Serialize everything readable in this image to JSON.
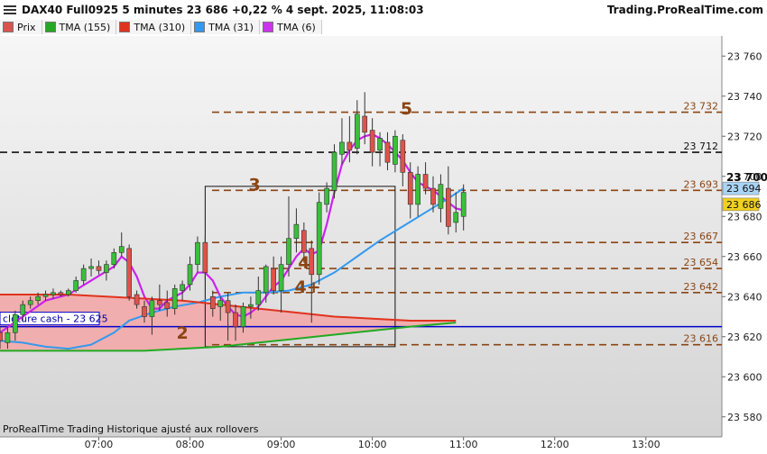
{
  "header": {
    "title": "DAX40 Full0925 5 minutes 23 686 +0,22 % 4 sept. 2025, 11:08:03",
    "site": "Trading.ProRealTime.com"
  },
  "legend": [
    {
      "label": "Prix",
      "color": "#d9534f"
    },
    {
      "label": "TMA (155)",
      "color": "#22aa22"
    },
    {
      "label": "TMA (310)",
      "color": "#e0331e"
    },
    {
      "label": "TMA (31)",
      "color": "#3399ee"
    },
    {
      "label": "TMA (6)",
      "color": "#cc33ee"
    }
  ],
  "footer": {
    "note": "ProRealTime Trading  Historique ajusté aux rollovers"
  },
  "chart_data": {
    "type": "candlestick",
    "ylim": [
      23570,
      23770
    ],
    "y_ticks": [
      23580,
      23600,
      23620,
      23640,
      23660,
      23680,
      23700,
      23720,
      23740,
      23760
    ],
    "y_tick_labels": [
      "23 580",
      "23 600",
      "23 620",
      "23 640",
      "23 660",
      "23 680",
      "23 700",
      "23 720",
      "23 740",
      "23 760"
    ],
    "x_ticks": [
      {
        "t": 84,
        "label": "07:00"
      },
      {
        "t": 96,
        "label": "08:00"
      },
      {
        "t": 108,
        "label": "09:00"
      },
      {
        "t": 120,
        "label": "10:00"
      },
      {
        "t": 132,
        "label": "11:00"
      },
      {
        "t": 144,
        "label": "12:00"
      },
      {
        "t": 156,
        "label": "13:00"
      }
    ],
    "xlim": [
      71,
      166
    ],
    "candles": [
      [
        71,
        23622,
        23625,
        23614,
        23618
      ],
      [
        72,
        23617,
        23625,
        23614,
        23622
      ],
      [
        73,
        23622,
        23633,
        23618,
        23631
      ],
      [
        74,
        23631,
        23638,
        23628,
        23636
      ],
      [
        75,
        23636,
        23640,
        23634,
        23638
      ],
      [
        76,
        23638,
        23642,
        23636,
        23640
      ],
      [
        77,
        23640,
        23643,
        23638,
        23641
      ],
      [
        78,
        23641,
        23644,
        23639,
        23642
      ],
      [
        79,
        23642,
        23643,
        23640,
        23641
      ],
      [
        80,
        23641,
        23644,
        23640,
        23643
      ],
      [
        81,
        23643,
        23650,
        23642,
        23648
      ],
      [
        82,
        23648,
        23656,
        23646,
        23654
      ],
      [
        83,
        23654,
        23659,
        23650,
        23655
      ],
      [
        84,
        23655,
        23658,
        23651,
        23653
      ],
      [
        85,
        23652,
        23658,
        23648,
        23656
      ],
      [
        86,
        23656,
        23664,
        23654,
        23662
      ],
      [
        87,
        23662,
        23672,
        23660,
        23665
      ],
      [
        88,
        23664,
        23666,
        23638,
        23640
      ],
      [
        89,
        23641,
        23643,
        23634,
        23636
      ],
      [
        90,
        23635,
        23638,
        23627,
        23630
      ],
      [
        91,
        23630,
        23640,
        23621,
        23638
      ],
      [
        92,
        23638,
        23646,
        23633,
        23636
      ],
      [
        93,
        23637,
        23643,
        23630,
        23634
      ],
      [
        94,
        23634,
        23646,
        23631,
        23644
      ],
      [
        95,
        23643,
        23648,
        23638,
        23646
      ],
      [
        96,
        23646,
        23660,
        23643,
        23656
      ],
      [
        97,
        23656,
        23670,
        23652,
        23667
      ],
      [
        98,
        23667,
        23670,
        23648,
        23652
      ],
      [
        99,
        23640,
        23643,
        23630,
        23634
      ],
      [
        100,
        23635,
        23640,
        23628,
        23638
      ],
      [
        101,
        23638,
        23642,
        23618,
        23632
      ],
      [
        102,
        23632,
        23636,
        23618,
        23625
      ],
      [
        103,
        23625,
        23637,
        23622,
        23635
      ],
      [
        104,
        23635,
        23640,
        23629,
        23636
      ],
      [
        105,
        23636,
        23650,
        23633,
        23643
      ],
      [
        106,
        23642,
        23656,
        23637,
        23655
      ],
      [
        107,
        23654,
        23660,
        23641,
        23643
      ],
      [
        108,
        23643,
        23660,
        23632,
        23656
      ],
      [
        109,
        23656,
        23690,
        23650,
        23669
      ],
      [
        110,
        23669,
        23684,
        23662,
        23676
      ],
      [
        111,
        23673,
        23677,
        23657,
        23662
      ],
      [
        112,
        23664,
        23668,
        23627,
        23651
      ],
      [
        113,
        23651,
        23692,
        23646,
        23687
      ],
      [
        114,
        23686,
        23697,
        23682,
        23694
      ],
      [
        115,
        23693,
        23716,
        23689,
        23712
      ],
      [
        116,
        23711,
        23729,
        23706,
        23717
      ],
      [
        117,
        23717,
        23730,
        23707,
        23713
      ],
      [
        118,
        23714,
        23738,
        23711,
        23731
      ],
      [
        119,
        23730,
        23742,
        23716,
        23722
      ],
      [
        120,
        23723,
        23729,
        23705,
        23712
      ],
      [
        121,
        23713,
        23722,
        23705,
        23719
      ],
      [
        122,
        23717,
        23722,
        23703,
        23707
      ],
      [
        123,
        23706,
        23723,
        23702,
        23720
      ],
      [
        124,
        23718,
        23721,
        23695,
        23702
      ],
      [
        125,
        23702,
        23707,
        23679,
        23686
      ],
      [
        126,
        23686,
        23705,
        23680,
        23701
      ],
      [
        127,
        23701,
        23707,
        23691,
        23694
      ],
      [
        128,
        23694,
        23700,
        23682,
        23686
      ],
      [
        129,
        23684,
        23701,
        23677,
        23696
      ],
      [
        130,
        23694,
        23705,
        23671,
        23675
      ],
      [
        131,
        23677,
        23692,
        23672,
        23682
      ],
      [
        132,
        23680,
        23696,
        23673,
        23692
      ]
    ],
    "series": [
      {
        "name": "TMA (6)",
        "color": "#cc22ee",
        "points": [
          [
            71,
            23622
          ],
          [
            74,
            23630
          ],
          [
            77,
            23638
          ],
          [
            80,
            23641
          ],
          [
            83,
            23648
          ],
          [
            86,
            23655
          ],
          [
            87,
            23660
          ],
          [
            88,
            23657
          ],
          [
            89,
            23650
          ],
          [
            90,
            23640
          ],
          [
            91,
            23634
          ],
          [
            92,
            23634
          ],
          [
            93,
            23638
          ],
          [
            94,
            23640
          ],
          [
            95,
            23642
          ],
          [
            96,
            23646
          ],
          [
            97,
            23652
          ],
          [
            98,
            23652
          ],
          [
            99,
            23648
          ],
          [
            100,
            23640
          ],
          [
            101,
            23635
          ],
          [
            102,
            23631
          ],
          [
            103,
            23630
          ],
          [
            104,
            23632
          ],
          [
            105,
            23635
          ],
          [
            106,
            23640
          ],
          [
            107,
            23645
          ],
          [
            108,
            23648
          ],
          [
            109,
            23654
          ],
          [
            110,
            23660
          ],
          [
            111,
            23664
          ],
          [
            112,
            23661
          ],
          [
            113,
            23663
          ],
          [
            114,
            23676
          ],
          [
            115,
            23692
          ],
          [
            116,
            23706
          ],
          [
            117,
            23713
          ],
          [
            118,
            23718
          ],
          [
            119,
            23720
          ],
          [
            120,
            23721
          ],
          [
            121,
            23719
          ],
          [
            122,
            23716
          ],
          [
            123,
            23712
          ],
          [
            124,
            23708
          ],
          [
            125,
            23702
          ],
          [
            126,
            23697
          ],
          [
            127,
            23695
          ],
          [
            128,
            23693
          ],
          [
            129,
            23690
          ],
          [
            130,
            23687
          ],
          [
            131,
            23684
          ],
          [
            132,
            23683
          ]
        ]
      },
      {
        "name": "TMA (31)",
        "color": "#3399ee",
        "points": [
          [
            71,
            23618
          ],
          [
            74,
            23617
          ],
          [
            77,
            23615
          ],
          [
            80,
            23614
          ],
          [
            83,
            23616
          ],
          [
            86,
            23622
          ],
          [
            88,
            23628
          ],
          [
            91,
            23632
          ],
          [
            94,
            23635
          ],
          [
            97,
            23637
          ],
          [
            100,
            23640
          ],
          [
            103,
            23642
          ],
          [
            106,
            23642
          ],
          [
            109,
            23643
          ],
          [
            112,
            23646
          ],
          [
            115,
            23652
          ],
          [
            118,
            23660
          ],
          [
            121,
            23668
          ],
          [
            124,
            23675
          ],
          [
            127,
            23682
          ],
          [
            130,
            23689
          ],
          [
            132,
            23694
          ]
        ]
      },
      {
        "name": "TMA (310)",
        "color": "#e0331e",
        "points": [
          [
            71,
            23641
          ],
          [
            75,
            23641
          ],
          [
            80,
            23641
          ],
          [
            85,
            23640
          ],
          [
            90,
            23639
          ],
          [
            95,
            23638
          ],
          [
            100,
            23636
          ],
          [
            105,
            23634
          ],
          [
            110,
            23632
          ],
          [
            115,
            23630
          ],
          [
            120,
            23629
          ],
          [
            125,
            23628
          ],
          [
            131,
            23628
          ]
        ]
      },
      {
        "name": "TMA (155)",
        "color": "#22aa22",
        "points": [
          [
            71,
            23613
          ],
          [
            80,
            23613
          ],
          [
            90,
            23613
          ],
          [
            95,
            23614
          ],
          [
            100,
            23615
          ],
          [
            105,
            23617
          ],
          [
            110,
            23619
          ],
          [
            115,
            23621
          ],
          [
            120,
            23623
          ],
          [
            125,
            23625
          ],
          [
            131,
            23627
          ]
        ]
      }
    ],
    "cloud": {
      "color": "#f4a6a6"
    },
    "levels": [
      {
        "value": 23732,
        "label": "23 732",
        "color": "#8b4513",
        "dash": true
      },
      {
        "value": 23712,
        "label": "23 712",
        "color": "#111111",
        "dash": true
      },
      {
        "value": 23693,
        "label": "23 693",
        "color": "#8b4513",
        "dash": true
      },
      {
        "value": 23667,
        "label": "23 667",
        "color": "#8b4513",
        "dash": true
      },
      {
        "value": 23654,
        "label": "23 654",
        "color": "#8b4513",
        "dash": true
      },
      {
        "value": 23642,
        "label": "23 642",
        "color": "#8b4513",
        "dash": true
      },
      {
        "value": 23616,
        "label": "23 616",
        "color": "#8b4513",
        "dash": true
      },
      {
        "value": 23625,
        "label": "clôture cash -  23 625",
        "color": "#0000cc",
        "dash": false
      }
    ],
    "price_tags": [
      {
        "value": 23694,
        "label": "23 694",
        "bg": "#aad4f5"
      },
      {
        "value": 23686,
        "label": "23 686",
        "bg": "#f0d020"
      }
    ],
    "box": {
      "t0": 98,
      "t1": 123,
      "y0": 23615,
      "y1": 23695
    },
    "wave_labels": [
      {
        "t": 95,
        "y": 23619,
        "text": "2"
      },
      {
        "t": 104.5,
        "y": 23693,
        "text": "3"
      },
      {
        "t": 111,
        "y": 23654,
        "text": "4"
      },
      {
        "t": 111.5,
        "y": 23642,
        "text": "4+"
      },
      {
        "t": 124.5,
        "y": 23731,
        "text": "5"
      }
    ],
    "current_price_label": "23 700"
  }
}
